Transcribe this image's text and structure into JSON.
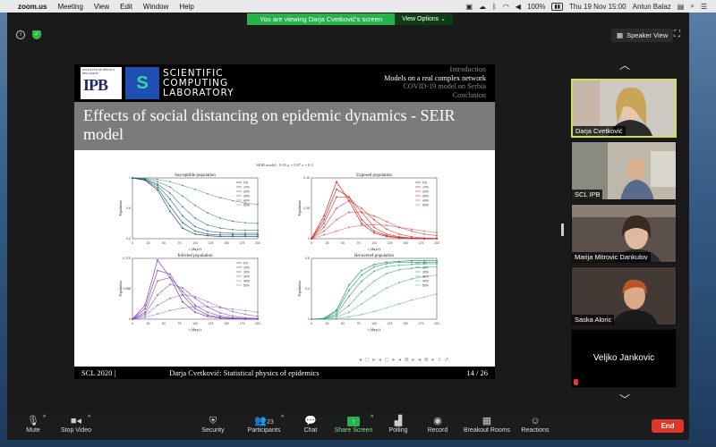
{
  "menubar": {
    "app": "zoom.us",
    "items": [
      "Meeting",
      "View",
      "Edit",
      "Window",
      "Help"
    ],
    "battery": "100%",
    "clock": "Thu 19 Nov  15:00",
    "user": "Antun Balaz"
  },
  "banner": {
    "text": "You are viewing Darja Cvetković's screen",
    "options": "View Options ⌄"
  },
  "view_button": "Speaker View",
  "slide": {
    "ipb_text": "INSTITUTE OF PHYSICS BELGRADE",
    "ipb_big": "IPB",
    "scl_line1": "SCIENTIFIC",
    "scl_line2": "COMPUTING",
    "scl_line3": "LABORATORY",
    "nav": [
      "Introduction",
      "Models on a real complex network",
      "COVID-19 model on Serbia",
      "Conclusion"
    ],
    "nav_active_index": 1,
    "title": "Effects of social distancing on epidemic dynamics - SEIR model",
    "figure_suptitle": "SEIR model - 0.05 μ = 0.07 ε = 0.3",
    "footer_left": "SCL 2020 |",
    "footer_center": "Darja Cvetković: Statistical physics of epidemics",
    "footer_right": "14 / 26",
    "beamer_nav": "◂ ◻ ▸ ◂ ◻ ▸ ◂ ≣ ▸ ◂ ≣ ▸  ≡  ↺"
  },
  "chart_data": [
    {
      "type": "line",
      "title": "Susceptible population",
      "xlabel": "t (days)",
      "ylabel": "Population",
      "color": "#1f5f7a",
      "x": [
        0,
        20,
        40,
        60,
        80,
        100,
        120,
        140,
        160,
        180,
        200
      ],
      "xticks": [
        "0",
        "25",
        "50",
        "75",
        "100",
        "125",
        "150",
        "175",
        "200"
      ],
      "ylim": [
        0.2,
        1.0
      ],
      "series": [
        {
          "name": "0%",
          "values": [
            1.0,
            0.97,
            0.84,
            0.56,
            0.34,
            0.26,
            0.24,
            0.23,
            0.23,
            0.23,
            0.23
          ]
        },
        {
          "name": "10%",
          "values": [
            1.0,
            0.97,
            0.87,
            0.63,
            0.41,
            0.3,
            0.26,
            0.25,
            0.25,
            0.25,
            0.25
          ]
        },
        {
          "name": "20%",
          "values": [
            1.0,
            0.98,
            0.9,
            0.72,
            0.5,
            0.36,
            0.3,
            0.28,
            0.27,
            0.27,
            0.27
          ]
        },
        {
          "name": "30%",
          "values": [
            1.0,
            0.98,
            0.92,
            0.8,
            0.62,
            0.47,
            0.38,
            0.34,
            0.32,
            0.31,
            0.31
          ]
        },
        {
          "name": "40%",
          "values": [
            1.0,
            0.99,
            0.95,
            0.88,
            0.76,
            0.64,
            0.54,
            0.47,
            0.43,
            0.41,
            0.4
          ]
        },
        {
          "name": "50%",
          "values": [
            1.0,
            0.99,
            0.98,
            0.95,
            0.9,
            0.85,
            0.79,
            0.74,
            0.7,
            0.67,
            0.65
          ]
        }
      ]
    },
    {
      "type": "line",
      "title": "Exposed population",
      "xlabel": "t (days)",
      "ylabel": "Population",
      "color": "#d62020",
      "x": [
        0,
        20,
        40,
        60,
        80,
        100,
        120,
        140,
        160,
        180,
        200
      ],
      "xticks": [
        "0",
        "25",
        "50",
        "75",
        "100",
        "125",
        "150",
        "175",
        "200"
      ],
      "ylim": [
        0,
        0.16
      ],
      "series": [
        {
          "name": "0%",
          "values": [
            0.0,
            0.06,
            0.15,
            0.1,
            0.04,
            0.015,
            0.006,
            0.002,
            0.001,
            0.0,
            0.0
          ]
        },
        {
          "name": "10%",
          "values": [
            0.0,
            0.05,
            0.13,
            0.11,
            0.05,
            0.02,
            0.008,
            0.003,
            0.001,
            0.0,
            0.0
          ]
        },
        {
          "name": "20%",
          "values": [
            0.0,
            0.04,
            0.11,
            0.11,
            0.07,
            0.03,
            0.012,
            0.005,
            0.002,
            0.001,
            0.0
          ]
        },
        {
          "name": "30%",
          "values": [
            0.0,
            0.03,
            0.08,
            0.1,
            0.08,
            0.05,
            0.025,
            0.012,
            0.005,
            0.002,
            0.001
          ]
        },
        {
          "name": "40%",
          "values": [
            0.0,
            0.02,
            0.05,
            0.07,
            0.07,
            0.06,
            0.045,
            0.03,
            0.02,
            0.012,
            0.008
          ]
        },
        {
          "name": "50%",
          "values": [
            0.0,
            0.01,
            0.02,
            0.03,
            0.035,
            0.037,
            0.035,
            0.03,
            0.025,
            0.02,
            0.016
          ]
        }
      ]
    },
    {
      "type": "line",
      "title": "Infected population",
      "xlabel": "t (days)",
      "ylabel": "Population",
      "color": "#7a3fb0",
      "x": [
        0,
        20,
        40,
        60,
        80,
        100,
        120,
        140,
        160,
        180,
        200
      ],
      "xticks": [
        "0",
        "25",
        "50",
        "75",
        "100",
        "125",
        "150",
        "175",
        "200"
      ],
      "ylim": [
        0,
        0.175
      ],
      "series": [
        {
          "name": "0%",
          "values": [
            0.0,
            0.04,
            0.17,
            0.12,
            0.05,
            0.02,
            0.008,
            0.003,
            0.001,
            0.0,
            0.0
          ]
        },
        {
          "name": "10%",
          "values": [
            0.0,
            0.03,
            0.14,
            0.13,
            0.07,
            0.03,
            0.012,
            0.005,
            0.002,
            0.001,
            0.0
          ]
        },
        {
          "name": "20%",
          "values": [
            0.0,
            0.02,
            0.11,
            0.12,
            0.08,
            0.04,
            0.02,
            0.009,
            0.004,
            0.002,
            0.001
          ]
        },
        {
          "name": "30%",
          "values": [
            0.0,
            0.015,
            0.07,
            0.1,
            0.09,
            0.06,
            0.035,
            0.018,
            0.009,
            0.004,
            0.002
          ]
        },
        {
          "name": "40%",
          "values": [
            0.0,
            0.01,
            0.04,
            0.06,
            0.07,
            0.065,
            0.05,
            0.035,
            0.022,
            0.014,
            0.008
          ]
        },
        {
          "name": "50%",
          "values": [
            0.0,
            0.005,
            0.015,
            0.025,
            0.032,
            0.036,
            0.036,
            0.033,
            0.029,
            0.025,
            0.02
          ]
        }
      ]
    },
    {
      "type": "line",
      "title": "Recovered population",
      "xlabel": "t (days)",
      "ylabel": "Population",
      "color": "#2ea36a",
      "x": [
        0,
        20,
        40,
        60,
        80,
        100,
        120,
        140,
        160,
        180,
        200
      ],
      "xticks": [
        "0",
        "25",
        "50",
        "75",
        "100",
        "125",
        "150",
        "175",
        "200"
      ],
      "ylim": [
        0,
        0.8
      ],
      "series": [
        {
          "name": "0%",
          "values": [
            0.0,
            0.01,
            0.12,
            0.45,
            0.64,
            0.72,
            0.75,
            0.76,
            0.77,
            0.77,
            0.77
          ]
        },
        {
          "name": "10%",
          "values": [
            0.0,
            0.01,
            0.1,
            0.38,
            0.58,
            0.69,
            0.73,
            0.75,
            0.75,
            0.75,
            0.75
          ]
        },
        {
          "name": "20%",
          "values": [
            0.0,
            0.005,
            0.07,
            0.3,
            0.5,
            0.63,
            0.69,
            0.71,
            0.72,
            0.73,
            0.73
          ]
        },
        {
          "name": "30%",
          "values": [
            0.0,
            0.004,
            0.05,
            0.18,
            0.36,
            0.5,
            0.6,
            0.65,
            0.67,
            0.68,
            0.69
          ]
        },
        {
          "name": "40%",
          "values": [
            0.0,
            0.003,
            0.03,
            0.09,
            0.2,
            0.31,
            0.41,
            0.48,
            0.53,
            0.56,
            0.58
          ]
        },
        {
          "name": "50%",
          "values": [
            0.0,
            0.001,
            0.01,
            0.03,
            0.06,
            0.1,
            0.15,
            0.2,
            0.25,
            0.29,
            0.33
          ]
        }
      ]
    }
  ],
  "participants": [
    {
      "name": "Darja Cvetković",
      "active": true,
      "bg": "#7a5a4a"
    },
    {
      "name": "SCL IPB",
      "active": false,
      "bg": "#b9b4a6"
    },
    {
      "name": "Marija Mitrovic Dankulov",
      "active": false,
      "bg": "#6a5a55"
    },
    {
      "name": "Saska Aloric",
      "active": false,
      "bg": "#3a3430"
    },
    {
      "name": "Veljko Jankovic",
      "active": false,
      "bg": "#000000"
    }
  ],
  "toolbar": {
    "mute": "Mute",
    "stop_video": "Stop Video",
    "security": "Security",
    "participants": "Participants",
    "participants_count": "23",
    "chat": "Chat",
    "share_screen": "Share Screen",
    "polling": "Polling",
    "record": "Record",
    "breakout": "Breakout Rooms",
    "reactions": "Reactions",
    "end": "End"
  }
}
